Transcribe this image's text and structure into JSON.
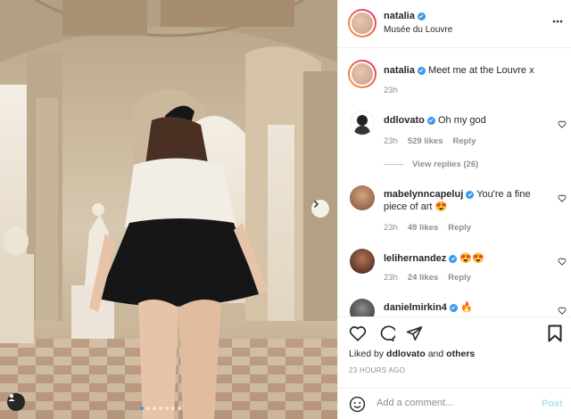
{
  "post": {
    "username": "natalia",
    "location": "Musée du Louvre",
    "carousel": {
      "slides": 7,
      "active_index": 0
    }
  },
  "caption": {
    "username": "natalia",
    "text": "Meet me at the Louvre x",
    "time": "23h"
  },
  "comments": [
    {
      "username": "ddlovato",
      "verified": true,
      "text": "Oh my god",
      "time": "23h",
      "likes": "529 likes",
      "reply": "Reply",
      "view_replies": "View replies (26)"
    },
    {
      "username": "mabelynncapeluj",
      "verified": true,
      "text": "You're a fine piece of art 😍",
      "time": "23h",
      "likes": "49 likes",
      "reply": "Reply"
    },
    {
      "username": "lelihernandez",
      "verified": true,
      "text": "😍😍",
      "time": "23h",
      "likes": "24 likes",
      "reply": "Reply"
    },
    {
      "username": "danielmirkin4",
      "verified": true,
      "text": "🔥"
    }
  ],
  "likes": {
    "prefix": "Liked by",
    "user": "ddlovato",
    "joiner": "and",
    "others": "others"
  },
  "timestamp": "23 HOURS AGO",
  "add_comment": {
    "placeholder": "Add a comment...",
    "post_label": "Post"
  },
  "icons": {
    "more": "more-horizontal-icon",
    "like": "heart-icon",
    "comment": "comment-bubble-icon",
    "share": "paper-plane-icon",
    "save": "bookmark-icon",
    "emoji": "smiley-icon",
    "next": "chevron-right-icon",
    "tags": "user-tag-icon"
  },
  "colors": {
    "verified": "#3897f0",
    "link_disabled": "#b2dffc",
    "muted": "#8e8e8e"
  }
}
